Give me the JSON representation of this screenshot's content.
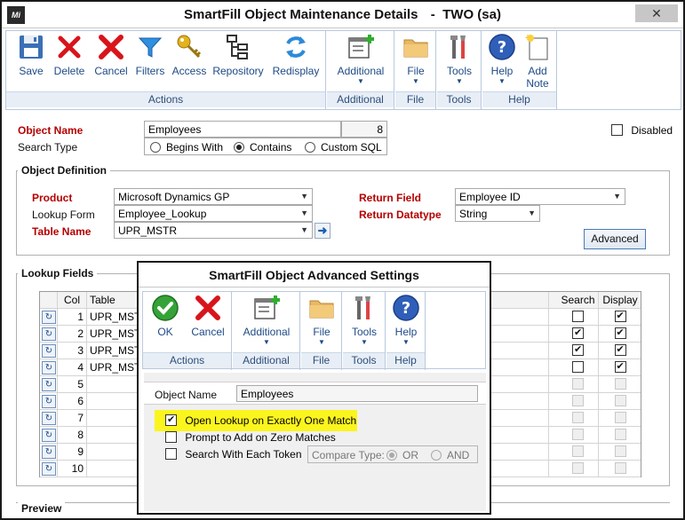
{
  "window": {
    "title": "SmartFill Object Maintenance Details",
    "company": "TWO (sa)",
    "close_glyph": "✕"
  },
  "ribbon": {
    "groups": [
      {
        "label": "Actions",
        "buttons": [
          {
            "label": "Save",
            "icon": "save-icon"
          },
          {
            "label": "Delete",
            "icon": "delete-icon"
          },
          {
            "label": "Cancel",
            "icon": "cancel-icon"
          },
          {
            "label": "Filters",
            "icon": "filter-icon"
          },
          {
            "label": "Access",
            "icon": "key-icon"
          },
          {
            "label": "Repository",
            "icon": "hierarchy-icon"
          },
          {
            "label": "Redisplay",
            "icon": "refresh-icon"
          }
        ]
      },
      {
        "label": "Additional",
        "buttons": [
          {
            "label": "Additional",
            "icon": "window-add-icon"
          }
        ]
      },
      {
        "label": "File",
        "buttons": [
          {
            "label": "File",
            "icon": "folder-icon"
          }
        ]
      },
      {
        "label": "Tools",
        "buttons": [
          {
            "label": "Tools",
            "icon": "tools-icon"
          }
        ]
      },
      {
        "label": "Help",
        "buttons": [
          {
            "label": "Help",
            "icon": "help-icon"
          },
          {
            "label": "Add Note",
            "icon": "note-icon"
          }
        ]
      }
    ],
    "arrow_glyph": "▼"
  },
  "form": {
    "object_name_label": "Object Name",
    "object_name_value": "Employees",
    "object_name_count": "8",
    "search_type_label": "Search Type",
    "search_options": [
      "Begins With",
      "Contains",
      "Custom SQL"
    ],
    "search_selected": "Contains",
    "disabled_label": "Disabled",
    "disabled_checked": false
  },
  "object_definition": {
    "title": "Object Definition",
    "product_label": "Product",
    "product_value": "Microsoft Dynamics GP",
    "lookup_form_label": "Lookup Form",
    "lookup_form_value": "Employee_Lookup",
    "table_name_label": "Table Name",
    "table_name_value": "UPR_MSTR",
    "return_field_label": "Return Field",
    "return_field_value": "Employee ID",
    "return_datatype_label": "Return Datatype",
    "return_datatype_value": "String",
    "advanced_label": "Advanced",
    "goto_glyph": "➜"
  },
  "lookup_fields": {
    "title": "Lookup Fields",
    "headers": {
      "col": "Col",
      "table": "Table",
      "search": "Search",
      "display": "Display"
    },
    "rows": [
      {
        "col": "1",
        "table": "UPR_MST",
        "search": false,
        "display": true,
        "enabled": true
      },
      {
        "col": "2",
        "table": "UPR_MST",
        "search": true,
        "display": true,
        "enabled": true
      },
      {
        "col": "3",
        "table": "UPR_MST",
        "search": true,
        "display": true,
        "enabled": true
      },
      {
        "col": "4",
        "table": "UPR_MST",
        "search": false,
        "display": true,
        "enabled": true
      },
      {
        "col": "5",
        "table": "",
        "search": false,
        "display": false,
        "enabled": false
      },
      {
        "col": "6",
        "table": "",
        "search": false,
        "display": false,
        "enabled": false
      },
      {
        "col": "7",
        "table": "",
        "search": false,
        "display": false,
        "enabled": false
      },
      {
        "col": "8",
        "table": "",
        "search": false,
        "display": false,
        "enabled": false
      },
      {
        "col": "9",
        "table": "",
        "search": false,
        "display": false,
        "enabled": false
      },
      {
        "col": "10",
        "table": "",
        "search": false,
        "display": false,
        "enabled": false
      }
    ],
    "row_button_glyph": "↻"
  },
  "preview": {
    "title": "Preview"
  },
  "dialog": {
    "title": "SmartFill Object Advanced Settings",
    "groups": [
      {
        "label": "Actions",
        "buttons": [
          {
            "label": "OK",
            "icon": "ok-icon"
          },
          {
            "label": "Cancel",
            "icon": "cancel-icon"
          }
        ]
      },
      {
        "label": "Additional",
        "buttons": [
          {
            "label": "Additional",
            "icon": "window-add-icon"
          }
        ]
      },
      {
        "label": "File",
        "buttons": [
          {
            "label": "File",
            "icon": "folder-icon"
          }
        ]
      },
      {
        "label": "Tools",
        "buttons": [
          {
            "label": "Tools",
            "icon": "tools-icon"
          }
        ]
      },
      {
        "label": "Help",
        "buttons": [
          {
            "label": "Help",
            "icon": "help-icon"
          }
        ]
      }
    ],
    "object_name_label": "Object Name",
    "object_name_value": "Employees",
    "options": [
      {
        "label": "Open Lookup on Exactly One Match",
        "checked": true
      },
      {
        "label": "Prompt to Add on Zero Matches",
        "checked": false
      },
      {
        "label": "Search With Each Token",
        "checked": false
      }
    ],
    "compare_type_label": "Compare Type:",
    "compare_options": [
      "OR",
      "AND"
    ],
    "compare_selected": "OR",
    "highlight_color": "#fbf51e"
  }
}
